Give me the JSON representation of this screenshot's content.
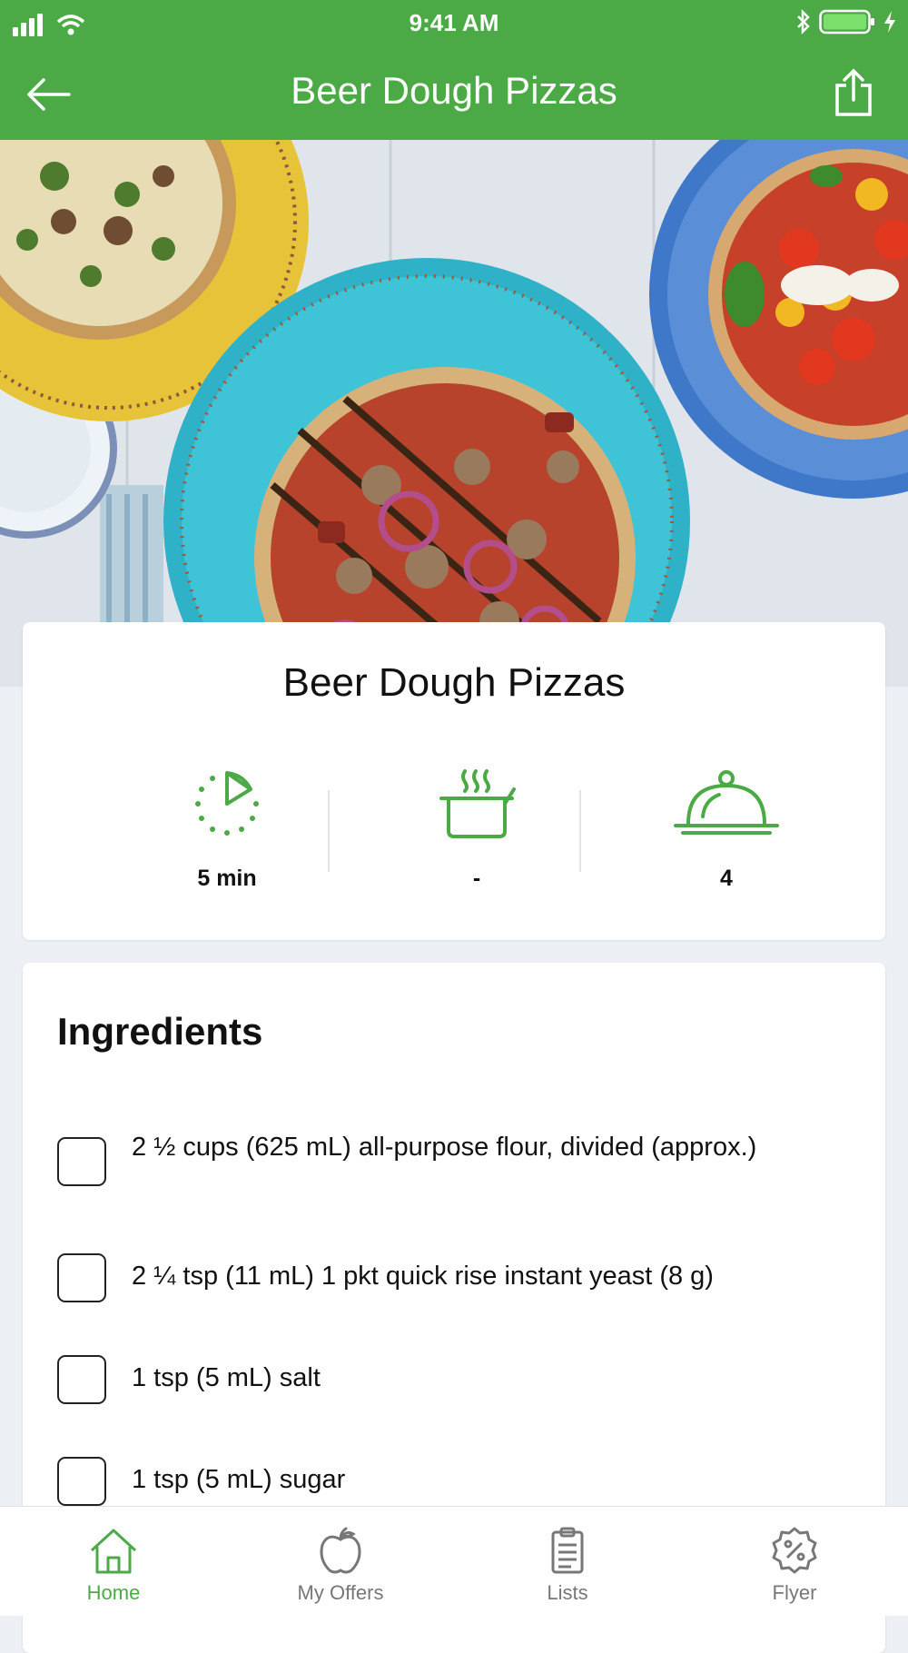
{
  "status_bar": {
    "time": "9:41 AM"
  },
  "header": {
    "title": "Beer Dough Pizzas"
  },
  "recipe": {
    "title": "Beer Dough Pizzas",
    "stats": [
      {
        "icon": "timer-icon",
        "value": "5 min"
      },
      {
        "icon": "cooking-pot-icon",
        "value": "-"
      },
      {
        "icon": "serving-cloche-icon",
        "value": "4"
      }
    ]
  },
  "ingredients": {
    "heading": "Ingredients",
    "items": [
      {
        "text": "2 ½ cups  (625 mL) all-purpose flour, divided (approx.)"
      },
      {
        "text": "2 ¼ tsp (11 mL) 1 pkt quick rise instant yeast (8 g)"
      },
      {
        "text": "1 tsp  (5 mL)  salt"
      },
      {
        "text": "1 tsp  (5 mL) sugar"
      }
    ]
  },
  "tabs": [
    {
      "label": "Home",
      "icon": "home-icon",
      "active": true
    },
    {
      "label": "My Offers",
      "icon": "apple-icon",
      "active": false
    },
    {
      "label": "Lists",
      "icon": "clipboard-icon",
      "active": false
    },
    {
      "label": "Flyer",
      "icon": "percent-badge-icon",
      "active": false
    }
  ],
  "colors": {
    "brand_green": "#4caa46",
    "background": "#ecf0f4"
  }
}
